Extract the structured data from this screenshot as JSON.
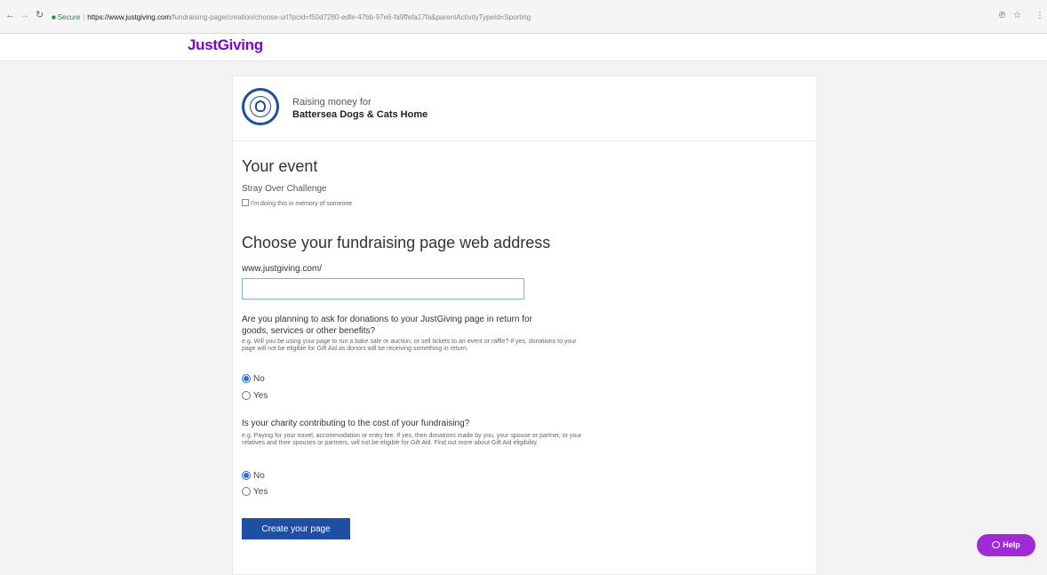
{
  "browser": {
    "back_icon": "back-arrow-icon",
    "forward_icon": "forward-arrow-icon",
    "reload_icon": "reload-icon",
    "secure_label": "Secure",
    "url_host": "https://www.justgiving.com",
    "url_rest": "/fundraising-page/creation/choose-url?pcid=f50d7280-edfe-47bb-97e6-fa9ffefa17fa&parentActivityTypeId=Sporting"
  },
  "header": {
    "logo_text": "JustGiving",
    "brand_color": "#7a04dd"
  },
  "charity": {
    "raising_label": "Raising money for",
    "name": "Battersea Dogs & Cats Home"
  },
  "event": {
    "heading": "Your event",
    "name": "Stray Over Challenge",
    "memory_checkbox_label": "I'm doing this in memory of someone",
    "memory_checked": false
  },
  "address": {
    "heading": "Choose your fundraising page web address",
    "prefix": "www.justgiving.com/",
    "value": ""
  },
  "q1": {
    "text_line1": "Are you planning to ask for donations to your JustGiving page in return for",
    "text_line2": "goods, services or other benefits?",
    "hint": "e.g. Will you be using your page to run a bake sale or auction, or sell tickets to an event or raffle? If yes, donations to your page will not be eligible for Gift Aid as donors will be receiving something in return.",
    "options": [
      "No",
      "Yes"
    ],
    "selected": "No"
  },
  "q2": {
    "text": "Is your charity contributing to the cost of your fundraising?",
    "hint": "e.g. Paying for your travel, accommodation or entry fee. If yes, then donations made by you, your spouse or partner, or your relatives and their spouses or partners, will not be eligible for Gift Aid. Find out more about Gift Aid eligibility",
    "options": [
      "No",
      "Yes"
    ],
    "selected": "No"
  },
  "submit_label": "Create your page",
  "help_label": "Help",
  "help_color": "#a02ad8"
}
